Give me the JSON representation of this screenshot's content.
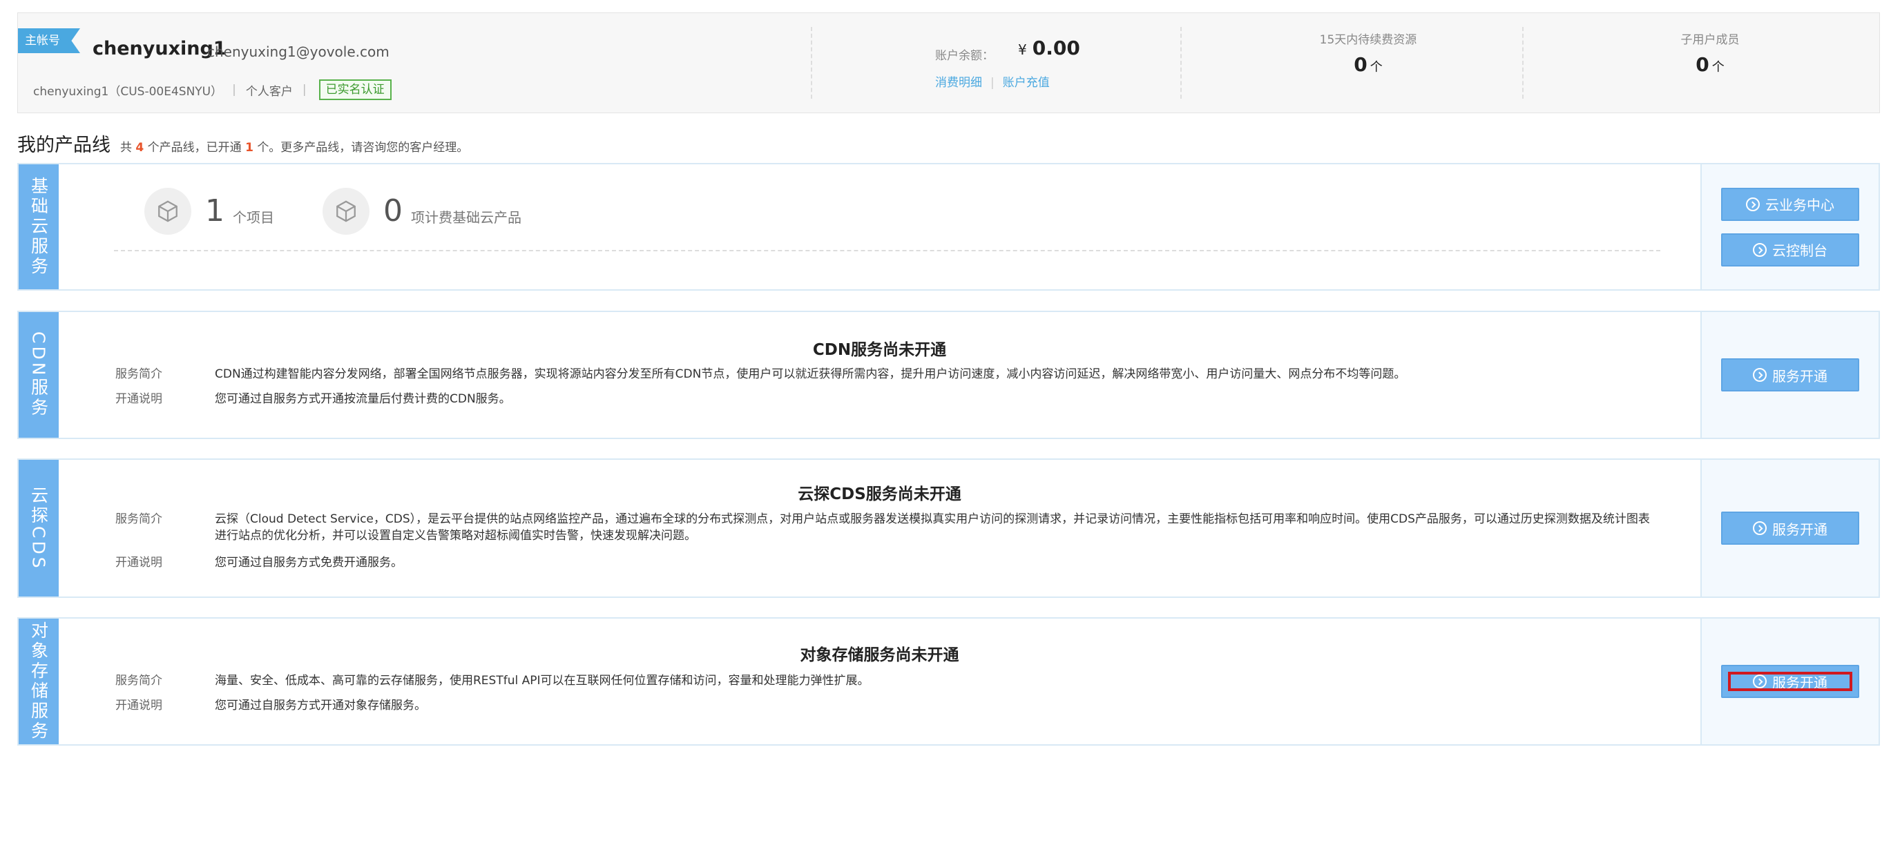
{
  "account": {
    "tag": "主帐号",
    "name": "chenyuxing1",
    "email": "chenyuxing1@yovole.com",
    "id_text": "chenyuxing1（CUS-00E4SNYU）",
    "customer_type": "个人客户",
    "verified": "已实名认证",
    "balance_label": "账户余额：",
    "currency": "¥",
    "balance": "0.00",
    "link_details": "消费明细",
    "link_recharge": "账户充值",
    "pending_label": "15天内待续费资源",
    "pending_value": "0",
    "pending_unit": "个",
    "sub_label": "子用户成员",
    "sub_value": "0",
    "sub_unit": "个"
  },
  "productline": {
    "title": "我的产品线",
    "sub_prefix": "共",
    "total": "4",
    "sub_mid": "个产品线，已开通",
    "opened": "1",
    "sub_suffix": "个。更多产品线，请咨询您的客户经理。"
  },
  "basic_cloud": {
    "side": "基础云服务",
    "projects_num": "1",
    "projects_label": "个项目",
    "products_num": "0",
    "products_label": "项计费基础云产品",
    "btn_center": "云业务中心",
    "btn_console": "云控制台"
  },
  "cdn": {
    "side": "CDN服务",
    "heading": "CDN服务尚未开通",
    "intro_key": "服务简介",
    "intro": "CDN通过构建智能内容分发网络，部署全国网络节点服务器，实现将源站内容分发至所有CDN节点，使用户可以就近获得所需内容，提升用户访问速度，减小内容访问延迟，解决网络带宽小、用户访问量大、网点分布不均等问题。",
    "note_key": "开通说明",
    "note": "您可通过自服务方式开通按流量后付费计费的CDN服务。",
    "btn": "服务开通"
  },
  "cds": {
    "side": "云探CDS",
    "heading": "云探CDS服务尚未开通",
    "intro_key": "服务简介",
    "intro": "云探（Cloud Detect Service，CDS），是云平台提供的站点网络监控产品，通过遍布全球的分布式探测点，对用户站点或服务器发送模拟真实用户访问的探测请求，并记录访问情况，主要性能指标包括可用率和响应时间。使用CDS产品服务，可以通过历史探测数据及统计图表进行站点的优化分析，并可以设置自定义告警策略对超标阈值实时告警，快速发现解决问题。",
    "note_key": "开通说明",
    "note": "您可通过自服务方式免费开通服务。",
    "btn": "服务开通"
  },
  "oss": {
    "side": "对象存储服务",
    "heading": "对象存储服务尚未开通",
    "intro_key": "服务简介",
    "intro": "海量、安全、低成本、高可靠的云存储服务，使用RESTful API可以在互联网任何位置存储和访问，容量和处理能力弹性扩展。",
    "note_key": "开通说明",
    "note": "您可通过自服务方式开通对象存储服务。",
    "btn": "服务开通"
  }
}
